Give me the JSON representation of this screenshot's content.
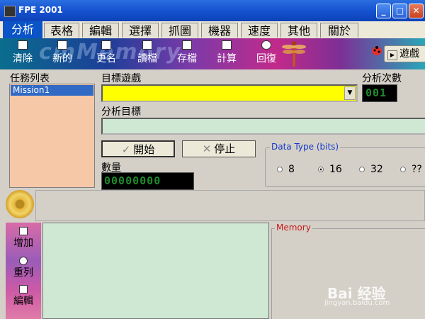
{
  "window": {
    "title": "FPE 2001",
    "minimize": "_",
    "maximize": "□",
    "close": "✕"
  },
  "tabs": [
    "分析",
    "表格",
    "編輯",
    "選擇",
    "抓圖",
    "機器",
    "速度",
    "其他",
    "關於"
  ],
  "toolbar": {
    "watermark": "cmMemory",
    "buttons": [
      "清除",
      "新的",
      "更名",
      "讀檔",
      "存檔",
      "計算",
      "回復"
    ],
    "game_button": "遊戲"
  },
  "labels": {
    "task_list": "任務列表",
    "target_game": "目標遊戲",
    "analysis_count": "分析次數",
    "analysis_target": "分析目標",
    "quantity": "數量"
  },
  "task_list": {
    "items": [
      "Mission1"
    ]
  },
  "target_game": {
    "value": ""
  },
  "analysis_count": {
    "display": "001"
  },
  "analysis_target": {
    "value": ""
  },
  "buttons": {
    "start": "開始",
    "stop": "停止"
  },
  "quantity": {
    "display": "00000000"
  },
  "data_type": {
    "legend": "Data Type (bits)",
    "options": [
      "8",
      "16",
      "32",
      "??"
    ],
    "selected": "16"
  },
  "side_tools": [
    "增加",
    "重列",
    "編輯"
  ],
  "memory": {
    "legend": "Memory"
  },
  "watermark": {
    "brand": "Bai 经验",
    "url": "jingyan.baidu.com"
  }
}
